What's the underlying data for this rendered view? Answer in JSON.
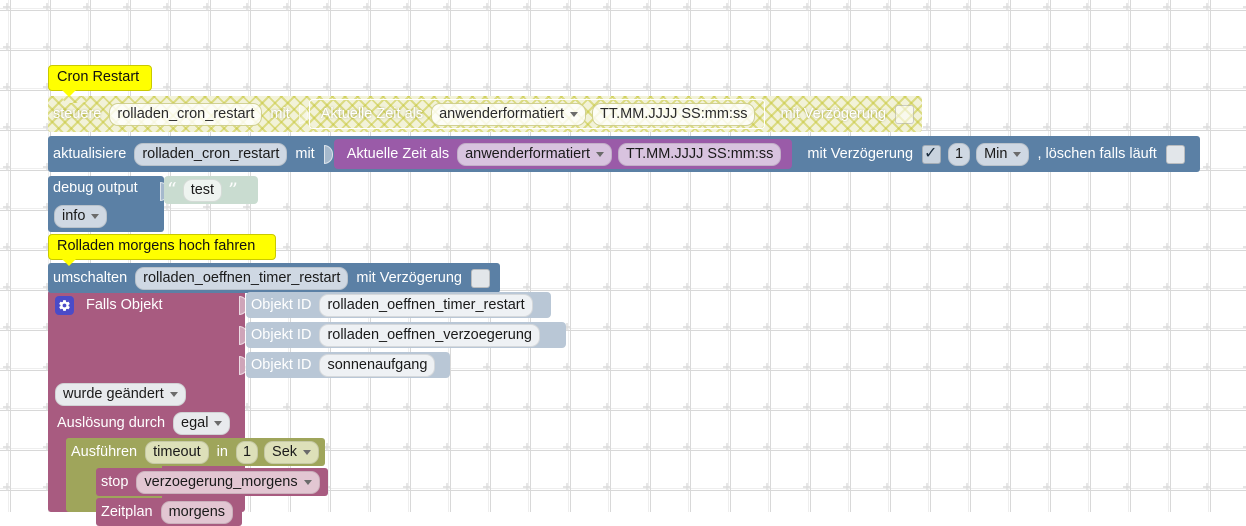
{
  "app": {
    "kind": "blockly-workspace",
    "language": "de",
    "background_color": "#ffffff",
    "grid_dot_color": "#d8d8d8"
  },
  "palette": {
    "blue": "#5b80a5",
    "violet": "#9a5ba8",
    "purple": "#a85b80",
    "olive": "#9fa55b",
    "string_green": "#c9dcd0",
    "steel": "#b9c7d6",
    "comment_yellow": "#ffff00",
    "disabled_hatch": "#f2f2d8",
    "mutator_blue": "#4b4bc8"
  },
  "comments": [
    {
      "text": "Cron Restart"
    },
    {
      "text": "Rolladen morgens hoch fahren"
    }
  ],
  "blocks": {
    "disabled_control": {
      "label": "steuere",
      "object_id": "rolladen_cron_restart",
      "with": "mit",
      "value_block": {
        "label": "Aktuelle Zeit als",
        "format_select": "anwenderformatiert",
        "format_value": "TT.MM.JJJJ SS:mm:ss"
      },
      "delay_label": "mit Verzögerung",
      "delay_checked": false
    },
    "update_control": {
      "label": "aktualisiere",
      "object_id": "rolladen_cron_restart",
      "with": "mit",
      "value_block": {
        "label": "Aktuelle Zeit als",
        "format_select": "anwenderformatiert",
        "format_value": "TT.MM.JJJJ SS:mm:ss"
      },
      "delay_label": "mit Verzögerung",
      "delay_checked": true,
      "delay_amount": "1",
      "delay_unit": "Min",
      "clear_running_label": ", löschen falls läuft",
      "clear_running_checked": false
    },
    "debug": {
      "label": "debug output",
      "severity": "info",
      "text_block": {
        "open_quote": "“",
        "value": "test",
        "close_quote": "”"
      }
    },
    "toggle": {
      "label": "umschalten",
      "object_id": "rolladen_oeffnen_timer_restart",
      "delay_label": "mit Verzögerung",
      "delay_checked": false
    },
    "on_trigger": {
      "label": "Falls Objekt",
      "mutator_icon": "gear-icon",
      "object_rows": [
        {
          "label": "Objekt ID",
          "value": "rolladen_oeffnen_timer_restart"
        },
        {
          "label": "Objekt ID",
          "value": "rolladen_oeffnen_verzoegerung"
        },
        {
          "label": "Objekt ID",
          "value": "sonnenaufgang"
        }
      ],
      "condition_select": "wurde geändert",
      "source_label": "Auslösung durch",
      "source_select": "egal"
    },
    "timeout": {
      "label": "Ausführen",
      "name_field": "timeout",
      "in_label": "in",
      "amount": "1",
      "unit": "Sek"
    },
    "stop_timer": {
      "label": "stop",
      "timer_select": "verzoegerung_morgens"
    },
    "schedule": {
      "label": "Zeitplan",
      "value": "morgens"
    }
  }
}
